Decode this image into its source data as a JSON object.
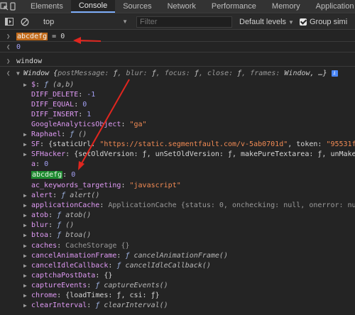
{
  "tabs": [
    {
      "label": "Elements",
      "active": false
    },
    {
      "label": "Console",
      "active": true
    },
    {
      "label": "Sources",
      "active": false
    },
    {
      "label": "Network",
      "active": false
    },
    {
      "label": "Performance",
      "active": false
    },
    {
      "label": "Memory",
      "active": false
    },
    {
      "label": "Application",
      "active": false
    }
  ],
  "toolbar": {
    "context": "top",
    "filter_placeholder": "Filter",
    "levels": "Default levels",
    "group_similar": "Group simi"
  },
  "console": {
    "input1_var": "abcdefg",
    "input1_rest": " = 0",
    "output1": "0",
    "input2": "window",
    "window_summary": {
      "name": "Window ",
      "open": "{",
      "props": [
        {
          "k": "postMessage",
          "v": "ƒ"
        },
        {
          "k": "blur",
          "v": "ƒ"
        },
        {
          "k": "focus",
          "v": "ƒ"
        },
        {
          "k": "close",
          "v": "ƒ"
        },
        {
          "k": "frames",
          "v": "Window"
        }
      ],
      "tail": ", …}"
    },
    "lines": [
      {
        "key": "$",
        "sep": ": ",
        "f": "ƒ",
        "val": " (a,b)"
      },
      {
        "key": "DIFF_DELETE",
        "sep": ": ",
        "num": "-1"
      },
      {
        "key": "DIFF_EQUAL",
        "sep": ": ",
        "num": "0"
      },
      {
        "key": "DIFF_INSERT",
        "sep": ": ",
        "num": "1"
      },
      {
        "key": "GoogleAnalyticsObject",
        "sep": ": ",
        "str": "\"ga\""
      },
      {
        "key": "Raphael",
        "sep": ": ",
        "f": "ƒ",
        "val": " ()"
      },
      {
        "key": "SF",
        "sep": ": ",
        "text": "{staticUrl: ",
        "str": "\"https://static.segmentfault.com/v-5ab0701d\"",
        "text2": ", token: ",
        "str2": "\"95531fb"
      },
      {
        "key": "SFHacker",
        "sep": ": ",
        "text": "{setOldVersion: ƒ, unSetOldVersion: ƒ, makePureTextarea: ƒ, unMakeP"
      },
      {
        "key": "a",
        "sep": ": ",
        "num": "0"
      },
      {
        "key": "abcdefg",
        "sep": ": ",
        "num": "0"
      },
      {
        "key": "ac_keywords_targeting",
        "sep": ": ",
        "str": "\"javascript\""
      },
      {
        "key": "alert",
        "sep": ": ",
        "f": "ƒ",
        "val": " alert()"
      },
      {
        "key": "applicationCache",
        "sep": ": ",
        "text": "ApplicationCache {status: 0, onchecking: null, onerror: nul"
      },
      {
        "key": "atob",
        "sep": ": ",
        "f": "ƒ",
        "val": " atob()"
      },
      {
        "key": "blur",
        "sep": ": ",
        "f": "ƒ",
        "val": " ()"
      },
      {
        "key": "btoa",
        "sep": ": ",
        "f": "ƒ",
        "val": " btoa()"
      },
      {
        "key": "caches",
        "sep": ": ",
        "text": "CacheStorage {}"
      },
      {
        "key": "cancelAnimationFrame",
        "sep": ": ",
        "f": "ƒ",
        "val": " cancelAnimationFrame()"
      },
      {
        "key": "cancelIdleCallback",
        "sep": ": ",
        "f": "ƒ",
        "val": " cancelIdleCallback()"
      },
      {
        "key": "captchaPostData",
        "sep": ": ",
        "text": "{}"
      },
      {
        "key": "captureEvents",
        "sep": ": ",
        "f": "ƒ",
        "val": " captureEvents()"
      },
      {
        "key": "chrome",
        "sep": ": ",
        "text": "{loadTimes: ƒ, csi: ƒ}"
      },
      {
        "key": "clearInterval",
        "sep": ": ",
        "f": "ƒ",
        "val": " clearInterval()"
      }
    ]
  },
  "colors": {
    "highlight_orange": "#c26a19",
    "highlight_green": "#1e8a30",
    "arrow_red": "#e0261f"
  }
}
